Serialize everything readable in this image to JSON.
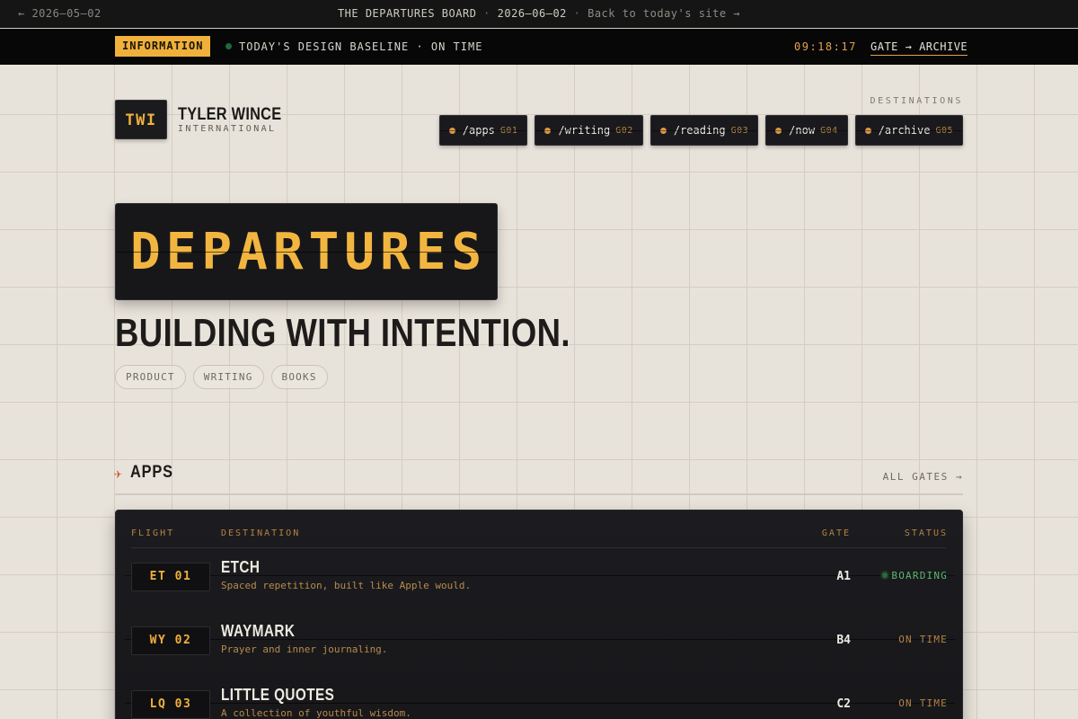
{
  "topbar": {
    "prev_date": "← 2026—05—02",
    "board_name": "THE DEPARTURES BOARD",
    "separator": "·",
    "current_date": "2026—06—02",
    "back_link": "Back to today's site →"
  },
  "infobar": {
    "badge": "INFORMATION",
    "baseline": "TODAY'S DESIGN BASELINE · ON TIME",
    "clock": "09:18:17",
    "gate_link": "GATE → ARCHIVE"
  },
  "brand": {
    "logo": "TWI",
    "name": "TYLER WINCE",
    "sub": "INTERNATIONAL"
  },
  "nav": {
    "label": "DESTINATIONS",
    "items": [
      {
        "path": "/apps",
        "gate": "G01"
      },
      {
        "path": "/writing",
        "gate": "G02"
      },
      {
        "path": "/reading",
        "gate": "G03"
      },
      {
        "path": "/now",
        "gate": "G04"
      },
      {
        "path": "/archive",
        "gate": "G05"
      }
    ]
  },
  "hero": {
    "board": "DEPARTURES",
    "tagline": "BUILDING WITH INTENTION.",
    "chips": [
      "PRODUCT",
      "WRITING",
      "BOOKS"
    ]
  },
  "apps": {
    "icon": "airplane-icon",
    "title": "APPS",
    "all_gates": "ALL GATES →",
    "columns": {
      "flight": "FLIGHT",
      "destination": "DESTINATION",
      "gate": "GATE",
      "status": "STATUS"
    },
    "rows": [
      {
        "flight": "ET 01",
        "name": "ETCH",
        "desc": "Spaced repetition, built like Apple would.",
        "gate": "A1",
        "status": "BOARDING"
      },
      {
        "flight": "WY 02",
        "name": "WAYMARK",
        "desc": "Prayer and inner journaling.",
        "gate": "B4",
        "status": "ON TIME"
      },
      {
        "flight": "LQ 03",
        "name": "LITTLE QUOTES",
        "desc": "A collection of youthful wisdom.",
        "gate": "C2",
        "status": "ON TIME"
      }
    ]
  },
  "colors": {
    "accent": "#f0b13c",
    "boarding": "#5bb86c",
    "board_bg": "#17171a",
    "page_bg": "#e8e3da"
  }
}
